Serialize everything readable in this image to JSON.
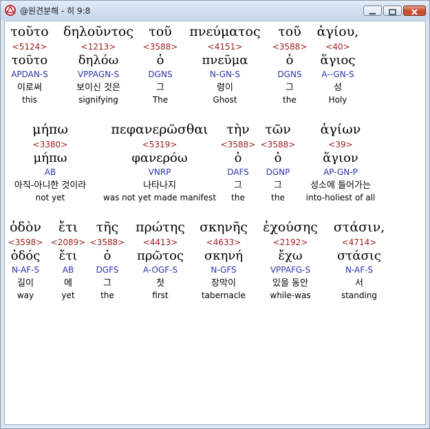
{
  "window": {
    "title": "@원견분해 - 히 9:8",
    "controls": [
      "minimize",
      "maximize",
      "close"
    ]
  },
  "colors": {
    "strong_number": "#9b1b1b",
    "parsing_code": "#2a33a8",
    "text": "#000000"
  },
  "lines": [
    {
      "words": [
        {
          "greek": "τοῦτο",
          "strong": "<5124>",
          "lemma": "τοῦτο",
          "parse": "APDAN-S",
          "korean": "이로써",
          "english": "this"
        },
        {
          "greek": "δηλοῦντος",
          "strong": "<1213>",
          "lemma": "δηλόω",
          "parse": "VPPAGN-S",
          "korean": "보이신 것은",
          "english": "signifying"
        },
        {
          "greek": "τοῦ",
          "strong": "<3588>",
          "lemma": "ὁ",
          "parse": "DGNS",
          "korean": "그",
          "english": "The"
        },
        {
          "greek": "πνεύματος",
          "strong": "<4151>",
          "lemma": "πνεῦμα",
          "parse": "N-GN-S",
          "korean": "령이",
          "english": "Ghost"
        },
        {
          "greek": "τοῦ",
          "strong": "<3588>",
          "lemma": "ὁ",
          "parse": "DGNS",
          "korean": "그",
          "english": "the"
        },
        {
          "greek": "ἁγίου,",
          "strong": "<40>",
          "lemma": "ἅγιος",
          "parse": "A--GN-S",
          "korean": "성",
          "english": "Holy"
        }
      ]
    },
    {
      "words": [
        {
          "greek": "μήπω",
          "strong": "<3380>",
          "lemma": "μήπω",
          "parse": "AB",
          "korean": "아직-아니한 것이라",
          "english": "not yet"
        },
        {
          "greek": "πεφανερῶσθαι",
          "strong": "<5319>",
          "lemma": "φανερόω",
          "parse": "VNRP",
          "korean": "나타나지",
          "english": "was not yet made manifest"
        },
        {
          "greek": "τὴν",
          "strong": "<3588>",
          "lemma": "ὁ",
          "parse": "DAFS",
          "korean": "그",
          "english": "the"
        },
        {
          "greek": "τῶν",
          "strong": "<3588>",
          "lemma": "ὁ",
          "parse": "DGNP",
          "korean": "그",
          "english": "the"
        },
        {
          "greek": "ἁγίων",
          "strong": "<39>",
          "lemma": "ἅγιον",
          "parse": "AP-GN-P",
          "korean": "성소에 들어가는",
          "english": "into-holiest of all"
        }
      ]
    },
    {
      "words": [
        {
          "greek": "ὁδὸν",
          "strong": "<3598>",
          "lemma": "ὁδός",
          "parse": "N-AF-S",
          "korean": "길이",
          "english": "way"
        },
        {
          "greek": "ἔτι",
          "strong": "<2089>",
          "lemma": "ἔτι",
          "parse": "AB",
          "korean": "에",
          "english": "yet"
        },
        {
          "greek": "τῆς",
          "strong": "<3588>",
          "lemma": "ὁ",
          "parse": "DGFS",
          "korean": "그",
          "english": "the"
        },
        {
          "greek": "πρώτης",
          "strong": "<4413>",
          "lemma": "πρῶτος",
          "parse": "A-OGF-S",
          "korean": "첫",
          "english": "first"
        },
        {
          "greek": "σκηνῆς",
          "strong": "<4633>",
          "lemma": "σκηνή",
          "parse": "N-GFS",
          "korean": "장막이",
          "english": "tabernacle"
        },
        {
          "greek": "ἐχούσης",
          "strong": "<2192>",
          "lemma": "ἔχω",
          "parse": "VPPAFG-S",
          "korean": "있을 동안",
          "english": "while-was"
        },
        {
          "greek": "στάσιν,",
          "strong": "<4714>",
          "lemma": "στάσις",
          "parse": "N-AF-S",
          "korean": "서",
          "english": "standing"
        }
      ]
    }
  ]
}
